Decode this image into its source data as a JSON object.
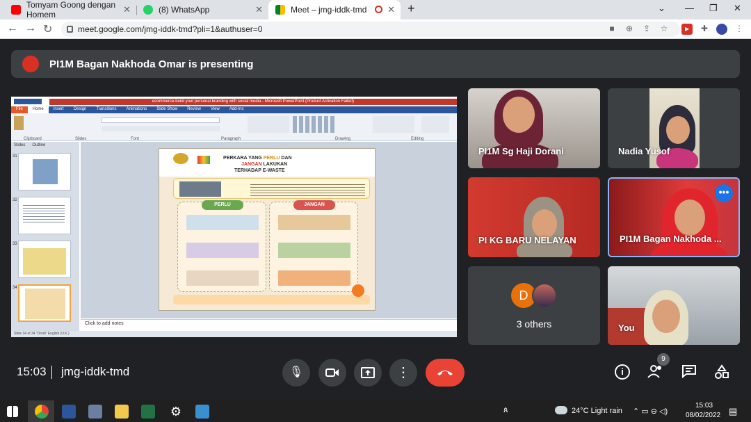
{
  "browser": {
    "tabs": [
      {
        "title": "Tomyam Goong dengan Homem"
      },
      {
        "title": "(8) WhatsApp"
      },
      {
        "title": "Meet – jmg-iddk-tmd"
      }
    ],
    "url": "meet.google.com/jmg-iddk-tmd?pli=1&authuser=0"
  },
  "meeting": {
    "presenting_banner": "PI1M Bagan Nakhoda Omar is presenting",
    "time": "15:03",
    "code": "jmg-iddk-tmd",
    "people_count": "9",
    "participants": [
      {
        "name": "PI1M Sg Haji Dorani"
      },
      {
        "name": "Nadia Yusof"
      },
      {
        "name": "PI KG BARU NELAYAN"
      },
      {
        "name": "PI1M Bagan Nakhoda ..."
      },
      {
        "name": "You"
      }
    ],
    "others_label": "3 others",
    "others_initial": "D"
  },
  "presentation": {
    "window_title": "ecommerce-build your personal branding with social media - Microsoft PowerPoint (Product Activation Failed)",
    "ribbon_tabs": [
      "File",
      "Home",
      "Insert",
      "Design",
      "Transitions",
      "Animations",
      "Slide Show",
      "Review",
      "View",
      "Add-Ins"
    ],
    "ribbon_groups": [
      "Clipboard",
      "Slides",
      "Font",
      "Paragraph",
      "Drawing",
      "Editing"
    ],
    "side_tabs": [
      "Slides",
      "Outline"
    ],
    "thumb_numbers": [
      "31",
      "32",
      "33",
      "34"
    ],
    "slide": {
      "title_line1_a": "PERKARA YANG ",
      "title_line1_b": "PERLU",
      "title_line1_c": " DAN",
      "title_line2_a": "JANGAN",
      "title_line2_b": " LAKUKAN",
      "title_line3": "TERHADAP E-WASTE",
      "perlu_label": "PERLU",
      "jangan_label": "JANGAN"
    },
    "notes_placeholder": "Click to add notes",
    "status": "Slide 34 of 34   \"Droid\"   English (U.K.)"
  },
  "taskbar": {
    "weather": "24°C  Light rain",
    "clock_time": "15:03",
    "clock_date": "08/02/2022"
  }
}
